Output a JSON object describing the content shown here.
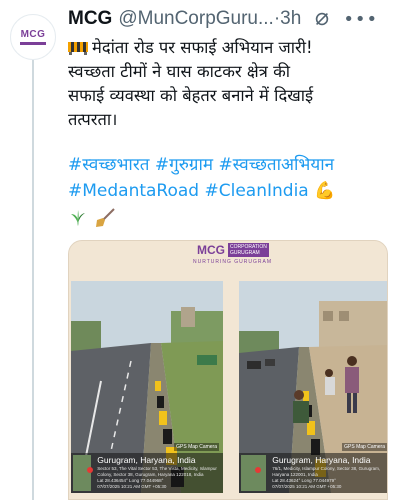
{
  "tweet": {
    "author_name": "MCG",
    "handle": "@MunCorpGuru...",
    "separator": "·",
    "time": "3h",
    "more_label": "•••",
    "avatar_text": "MCG",
    "line1": "मेदांता रोड पर सफाई अभियान जारी!",
    "line2": "स्वच्छता टीमों ने घास काटकर क्षेत्र की",
    "line3": "सफाई व्यवस्था को बेहतर बनाने में दिखाई",
    "line4": "तत्परता।",
    "hashtags": [
      "#स्वच्छभारत",
      "#गुरुग्राम",
      "#स्वच्छताअभियान",
      "#MedantaRoad",
      "#CleanIndia"
    ],
    "emojis": {
      "cone": "construction-cone-icon",
      "muscle": "💪",
      "herb": "🌿",
      "broom": "🧹"
    }
  },
  "media": {
    "logo": "MCG",
    "logo_badge": "CORPORATION\nGURUGRAM",
    "tagline": "NURTURING GURUGRAM",
    "photos": [
      {
        "city": "Gurugram, Haryana, India",
        "address": "Sector 53, The Vital Sector 53, The Vista, Medicity, Islampur Colony, Sector 38, Gurugram, Haryana 122018, India",
        "coords": "Lat 28.436454° Long 77.044968°",
        "datetime": "07/07/2025 10:21 AM GMT +05:30"
      },
      {
        "city": "Gurugram, Haryana, India",
        "address": "76/1, Medicity, Islampur Colony, Sector 38, Gurugram, Haryana 122001, India",
        "coords": "Lat 28.43624° Long 77.044979°",
        "datetime": "07/07/2025 10:21 AM GMT +05:30"
      }
    ],
    "gps_label": "GPS Map Camera"
  },
  "colors": {
    "link": "#1d9bf0",
    "brand": "#7b3f98",
    "muted": "#536471"
  }
}
